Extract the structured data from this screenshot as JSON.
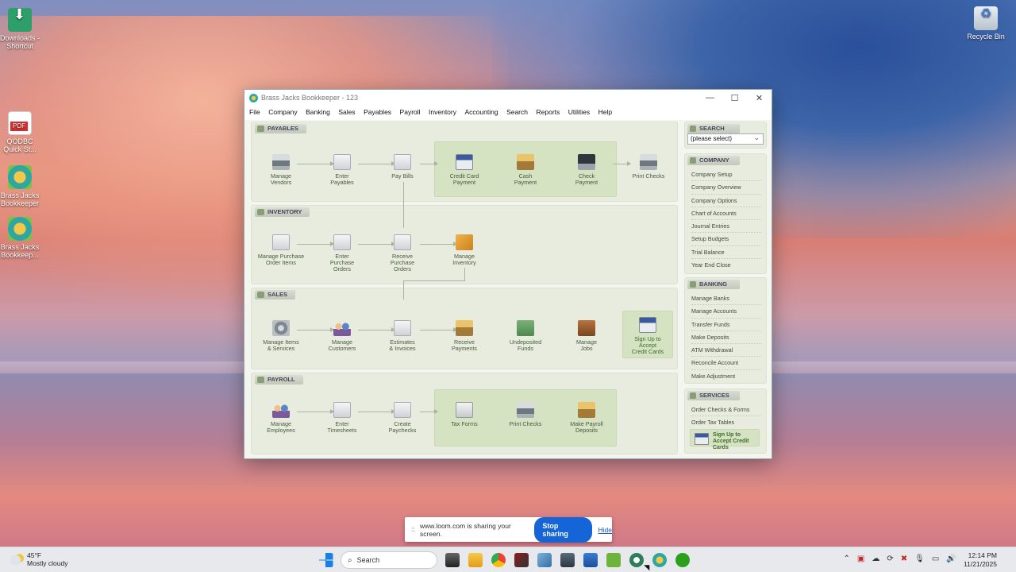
{
  "desktop": {
    "icons": [
      {
        "label": "Downloads - Shortcut"
      },
      {
        "label": "QODBC Quick St..."
      },
      {
        "label": "Brass Jacks Bookkeeper"
      },
      {
        "label": "Brass Jacks Bookkeep..."
      },
      {
        "label": "Recycle Bin"
      }
    ]
  },
  "window": {
    "title": "Brass Jacks Bookkeeper - 123",
    "controls": [
      "—",
      "☐",
      "✕"
    ],
    "menu": [
      "File",
      "Company",
      "Banking",
      "Sales",
      "Payables",
      "Payroll",
      "Inventory",
      "Accounting",
      "Search",
      "Reports",
      "Utilities",
      "Help"
    ]
  },
  "flow": {
    "payables": {
      "title": "PAYABLES",
      "nodes": [
        "Manage\nVendors",
        "Enter\nPayables",
        "Pay Bills",
        "Credit Card\nPayment",
        "Cash\nPayment",
        "Check\nPayment",
        "Print Checks"
      ]
    },
    "inventory": {
      "title": "INVENTORY",
      "nodes": [
        "Manage Purchase\nOrder Items",
        "Enter\nPurchase\nOrders",
        "Receive\nPurchase\nOrders",
        "Manage\nInventory"
      ]
    },
    "sales": {
      "title": "SALES",
      "nodes": [
        "Manage Items\n& Services",
        "Manage\nCustomers",
        "Estimates\n& Invoices",
        "Receive\nPayments",
        "Undeposited\nFunds",
        "Manage\nJobs",
        "Sign Up to\nAccept\nCredit Cards"
      ]
    },
    "payroll": {
      "title": "PAYROLL",
      "nodes": [
        "Manage\nEmployees",
        "Enter\nTimesheets",
        "Create\nPaychecks",
        "Tax Forms",
        "Print Checks",
        "Make Payroll\nDeposits"
      ]
    }
  },
  "sidebar": {
    "search": {
      "title": "SEARCH",
      "select_value": "(please select)"
    },
    "company": {
      "title": "COMPANY",
      "items": [
        "Company Setup",
        "Company Overview",
        "Company Options",
        "Chart of Accounts",
        "Journal Entries",
        "Setup Budgets",
        "Trial Balance",
        "Year End Close"
      ]
    },
    "banking": {
      "title": "BANKING",
      "items": [
        "Manage Banks",
        "Manage Accounts",
        "Transfer Funds",
        "Make Deposits",
        "ATM Withdrawal",
        "Reconcile Account",
        "Make Adjustment"
      ]
    },
    "services": {
      "title": "SERVICES",
      "items": [
        "Order Checks & Forms",
        "Order Tax Tables"
      ],
      "cc_label": "Sign Up to Accept Credit Cards"
    }
  },
  "loom": {
    "message": "www.loom.com is sharing your screen.",
    "stop_label": "Stop sharing",
    "hide_label": "Hide"
  },
  "taskbar": {
    "weather": {
      "temp": "45°F",
      "condition": "Mostly cloudy"
    },
    "search_label": "Search",
    "time": "12:14 PM",
    "date": "11/21/2025"
  }
}
